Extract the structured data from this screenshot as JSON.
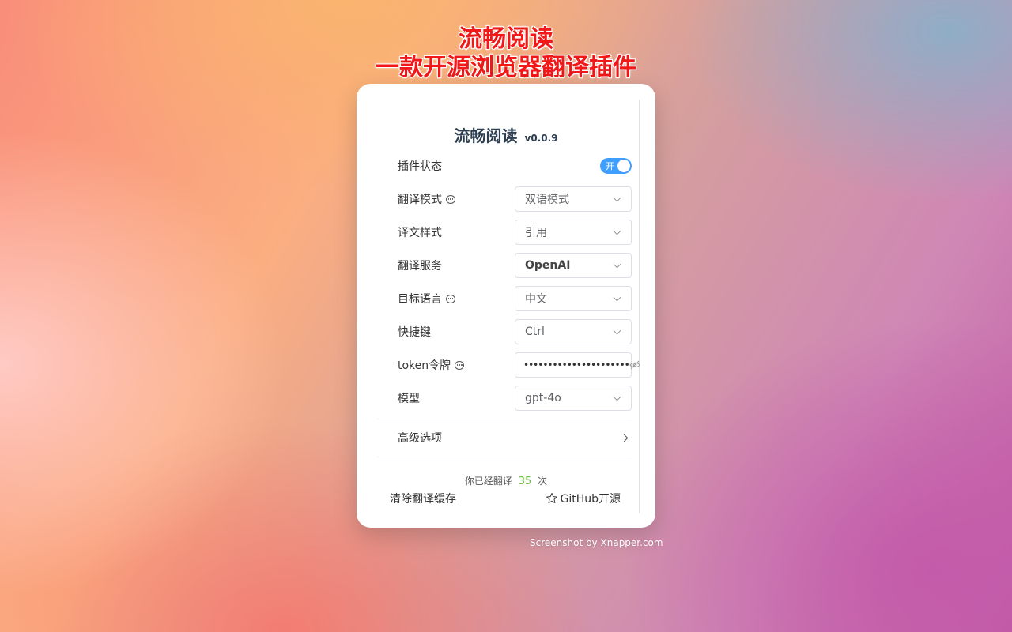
{
  "headline": {
    "line1": "流畅阅读",
    "line2": "一款开源浏览器翻译插件"
  },
  "popup": {
    "app_name": "流畅阅读",
    "version": "v0.0.9",
    "plugin_status": {
      "label": "插件状态",
      "toggle_text": "开",
      "enabled": true
    },
    "settings": [
      {
        "label": "翻译模式",
        "value": "双语模式",
        "has_hint": true
      },
      {
        "label": "译文样式",
        "value": "引用",
        "has_hint": false
      },
      {
        "label": "翻译服务",
        "value": "OpenAI",
        "has_hint": false
      },
      {
        "label": "目标语言",
        "value": "中文",
        "has_hint": true
      },
      {
        "label": "快捷键",
        "value": "Ctrl",
        "has_hint": false
      },
      {
        "label": "token令牌",
        "value": "••••••••••••••••••••••",
        "has_hint": true
      },
      {
        "label": "模型",
        "value": "gpt-4o",
        "has_hint": false
      }
    ],
    "advanced_label": "高级选项",
    "stats": {
      "prefix": "你已经翻译",
      "count": "35",
      "suffix": "次"
    },
    "clear_cache_label": "清除翻译缓存",
    "github_label": "GitHub开源"
  },
  "credit": "Screenshot by Xnapper.com",
  "colors": {
    "headline": "#f01818",
    "switch_on": "#409eff",
    "count": "#67c23a"
  },
  "icons": [
    "hint-icon",
    "chevron-down-icon",
    "eye-off-icon",
    "chevron-right-icon",
    "star-icon"
  ]
}
